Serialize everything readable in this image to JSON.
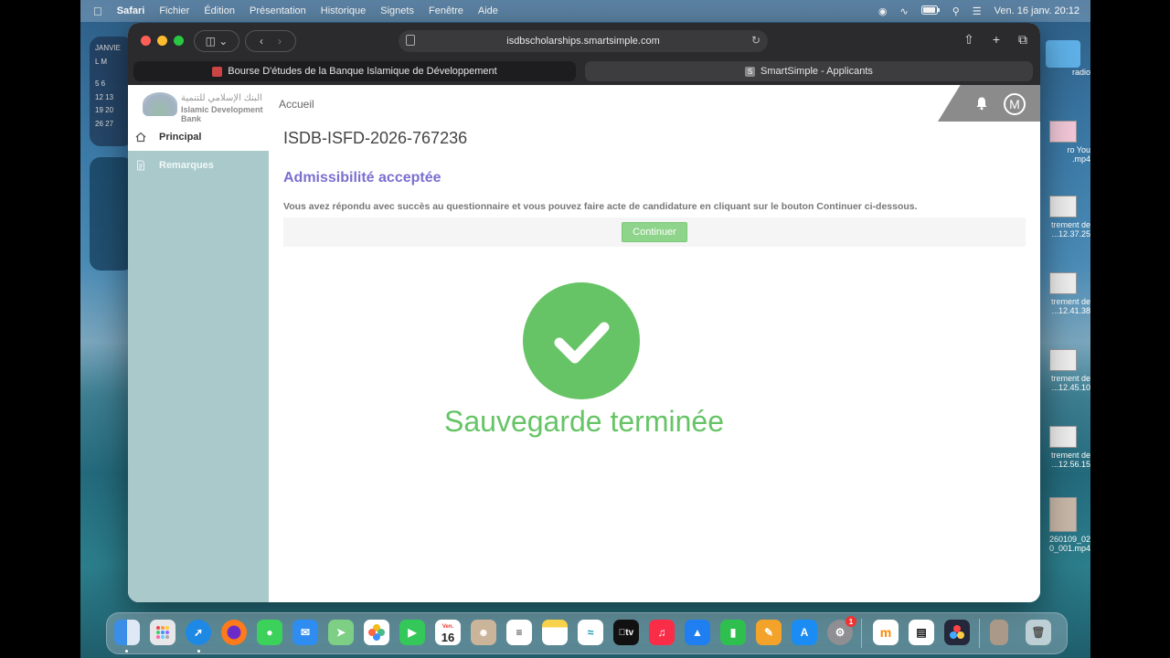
{
  "menubar": {
    "app_name": "Safari",
    "menus": [
      "Fichier",
      "Édition",
      "Présentation",
      "Historique",
      "Signets",
      "Fenêtre",
      "Aide"
    ],
    "clock": "Ven. 16 janv.  20:12"
  },
  "desktop": {
    "calendar_month": "JANVIE",
    "calendar_days_header": "L  M",
    "calendar_rows": [
      "5  6",
      "12 13",
      "19 20",
      "26 27"
    ],
    "files": [
      {
        "label": "radio"
      },
      {
        "label": "ro You\n.mp4"
      },
      {
        "label": "trement de\n...12.37.25"
      },
      {
        "label": "trement de\n...12.41.38"
      },
      {
        "label": "trement de\n...12.45.10"
      },
      {
        "label": "trement de\n...12.56.15"
      },
      {
        "label": "260109_02\n0_001.mp4"
      }
    ]
  },
  "browser": {
    "url": "isdbscholarships.smartsimple.com",
    "tabs": [
      {
        "title": "Bourse D'études de la Banque Islamique de Développement",
        "active": false
      },
      {
        "title": "SmartSimple - Applicants",
        "active": true,
        "favicon_letter": "S"
      }
    ]
  },
  "page": {
    "logo_arabic": "البنك الإسلامي للتنمية",
    "logo_english": "Islamic Development Bank",
    "breadcrumb": "Accueil",
    "sidebar": [
      {
        "label": "Principal",
        "icon": "home-icon",
        "active": true
      },
      {
        "label": "Remarques",
        "icon": "document-icon",
        "active": false
      }
    ],
    "avatar_letter": "M",
    "record_id": "ISDB-ISFD-2026-767236",
    "heading": "Admissibilité acceptée",
    "message": "Vous avez répondu avec succès au questionnaire et vous pouvez faire acte de candidature en cliquant sur le bouton Continuer ci-dessous.",
    "continue_label": "Continuer",
    "success_text": "Sauvegarde terminée"
  },
  "colors": {
    "heading": "#7a6fd0",
    "success": "#66c466",
    "sidebar": "#a9c9ca",
    "continue_button": "#8ed48a"
  },
  "dock": {
    "calendar_day": "16",
    "calendar_month": "Ven.",
    "settings_badge": "1",
    "apps": [
      "finder-icon",
      "launchpad-icon",
      "safari-icon",
      "firefox-icon",
      "messages-icon",
      "mail-icon",
      "maps-icon",
      "photos-icon",
      "facetime-icon",
      "calendar-icon",
      "contacts-icon",
      "reminders-icon",
      "notes-icon",
      "freeform-icon",
      "tv-icon",
      "music-icon",
      "keynote-icon",
      "numbers-icon",
      "pages-icon",
      "app-store-icon",
      "system-settings-icon",
      "moodle-icon",
      "clapper-icon",
      "davinci-icon",
      "video-thumb-icon",
      "trash-icon"
    ]
  }
}
